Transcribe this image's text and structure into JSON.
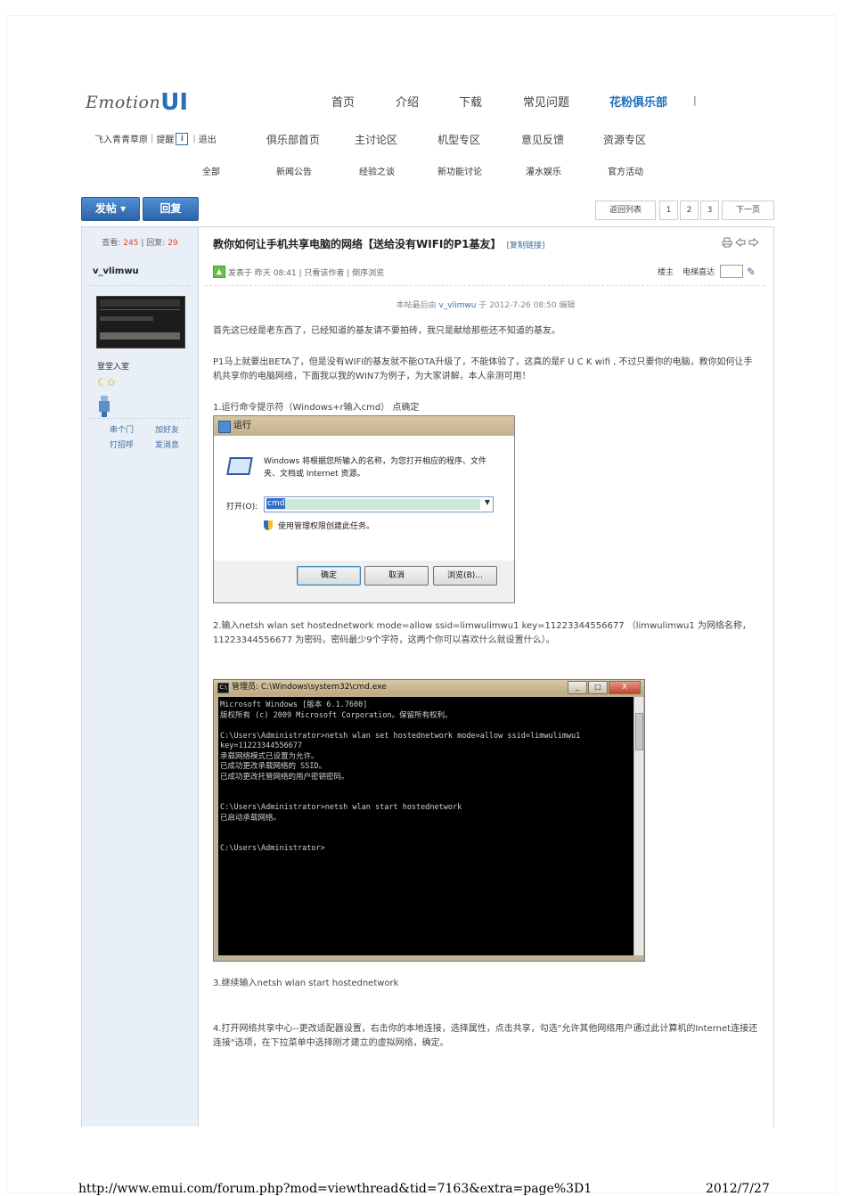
{
  "header": {
    "logo_text": "Emotion",
    "logo_u": "UI",
    "logo_sub": "",
    "nav": [
      "首页",
      "介绍",
      "下载",
      "常见问题",
      "花粉俱乐部",
      "|"
    ],
    "nav_active_color": "#1f6fbf",
    "topbar": {
      "user": "飞入青青草原",
      "sep1": "|",
      "remind": "提醒",
      "info_icon": "i",
      "sep2": "|",
      "logout": "退出"
    },
    "subnav": [
      "俱乐部首页",
      "主讨论区",
      "机型专区",
      "意见反馈",
      "资源专区"
    ],
    "subnav2": [
      "全部",
      "新闻公告",
      "经验之谈",
      "新功能讨论",
      "灌水娱乐",
      "官方活动"
    ]
  },
  "toolbar": {
    "post_label": "发帖 ▾",
    "reply_label": "回复",
    "back_label": "返回列表",
    "pages": [
      "1",
      "2",
      "3"
    ],
    "next_label": "下一页"
  },
  "sidebar": {
    "views_label": "查看:",
    "views": "245",
    "sep": "|",
    "replies_label": "回复:",
    "replies": "29",
    "username": "v_vlimwu",
    "rank": "登堂入室",
    "links": [
      "串个门",
      "加好友",
      "打招呼",
      "发消息"
    ]
  },
  "post": {
    "title": "教你如何让手机共享电脑的网络【送给没有WIFI的P1基友】",
    "copy_link": "[复制链接]",
    "meta": "发表于 昨天 08:41 | 只看该作者 | 倒序浏览",
    "owner": "楼主",
    "jump": "电梯直达",
    "edited_prefix": "本帖最后由",
    "edited_user": "v_vlimwu",
    "edited_suffix": "于 2012-7-26 08:50 编辑",
    "p1": "首先这已经是老东西了，已经知道的基友请不要拍砖，我只是献给那些还不知道的基友。",
    "p2": "P1马上就要出BETA了，但是没有WIFI的基友就不能OTA升级了，不能体验了，这真的是F U C K wifi , 不过只要你的电脑，教你如何让手机共享你的电脑网络，下面我以我的WIN7为例子，为大家讲解，本人亲测可用！",
    "step1": "1.运行命令提示符（Windows+r输入cmd） 点确定",
    "step2": "2.输入netsh wlan set hostednetwork mode=allow ssid=limwulimwu1 key=11223344556677 （limwulimwu1 为网络名称，11223344556677 为密码，密码最少9个字符，这两个你可以喜欢什么就设置什么）。",
    "step3": "3.继续输入netsh wlan start hostednetwork",
    "step4": "4.打开网络共享中心--更改适配器设置，右击你的本地连接，选择属性，点击共享，勾选\"允许其他网络用户通过此计算机的Internet连接还连接\"选项，在下拉菜单中选择刚才建立的虚拟网络，确定。"
  },
  "run_dialog": {
    "title": "运行",
    "desc": "Windows 将根据您所输入的名称，为您打开相应的程序、文件夹、文档或 Internet 资源。",
    "open_label": "打开(O):",
    "value": "cmd",
    "admin": "使用管理权限创建此任务。",
    "ok": "确定",
    "cancel": "取消",
    "browse": "浏览(B)..."
  },
  "cmd_window": {
    "title": "管理员: C:\\Windows\\system32\\cmd.exe",
    "icon_label": "C:\\",
    "min": "_",
    "max": "□",
    "close": "X",
    "lines": "Microsoft Windows [版本 6.1.7600]\n版权所有 (c) 2009 Microsoft Corporation。保留所有权利。\n\nC:\\Users\\Administrator>netsh wlan set hostednetwork mode=allow ssid=limwulimwu1\nkey=11223344556677\n承载网络模式已设置为允许。\n已成功更改承载网络的 SSID。\n已成功更改托管网络的用户密钥密码。\n\n\nC:\\Users\\Administrator>netsh wlan start hostednetwork\n已启动承载网络。\n\n\nC:\\Users\\Administrator>"
  },
  "footer": {
    "url": "http://www.emui.com/forum.php?mod=viewthread&tid=7163&extra=page%3D1",
    "date": "2012/7/27"
  }
}
